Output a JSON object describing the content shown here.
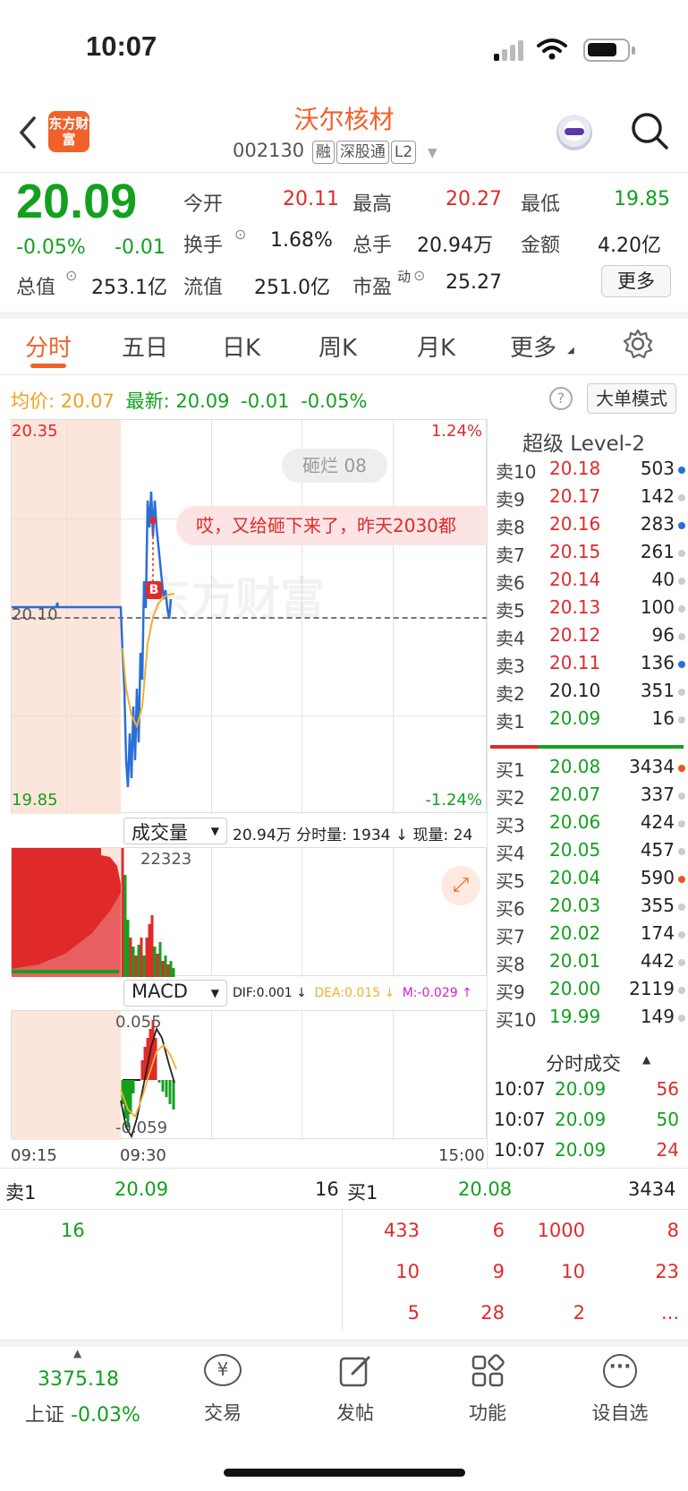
{
  "status_bar": {
    "time": "10:07"
  },
  "header": {
    "logo_text": "东方财富",
    "stock_name": "沃尔核材",
    "stock_code": "002130",
    "tags": [
      "融",
      "深股通",
      "L2"
    ]
  },
  "quote": {
    "price": "20.09",
    "change_pct": "-0.05%",
    "change": "-0.01",
    "open_label": "今开",
    "open": "20.11",
    "high_label": "最高",
    "high": "20.27",
    "low_label": "最低",
    "low": "19.85",
    "turnover_label": "换手",
    "turnover": "1.68%",
    "volume_label": "总手",
    "volume": "20.94万",
    "amount_label": "金额",
    "amount": "4.20亿",
    "mktcap_label": "总值",
    "mktcap": "253.1亿",
    "float_label": "流值",
    "float": "251.0亿",
    "pe_label": "市盈",
    "pe_sup": "动",
    "pe": "25.27",
    "more": "更多"
  },
  "tabs": [
    "分时",
    "五日",
    "日K",
    "周K",
    "月K",
    "更多"
  ],
  "avg_bar": {
    "avg_label": "均价:",
    "avg": "20.07",
    "latest_label": "最新:",
    "latest": "20.09",
    "chg": "-0.01",
    "chg_pct": "-0.05%",
    "mode": "大单模式"
  },
  "chart": {
    "y_top": "20.35",
    "y_mid": "20.10",
    "y_bottom": "19.85",
    "pct_top": "1.24%",
    "pct_bottom": "-1.24%",
    "watermark": "东方财富",
    "comment_user": "砸烂 08",
    "comment_text": "哎，又给砸下来了，昨天2030都",
    "marker": "B",
    "x_start": "09:15",
    "x_open": "09:30",
    "x_end": "15:00"
  },
  "volume_panel": {
    "selector": "成交量",
    "info": "20.94万 分时量: 1934 ↓ 现量: 24",
    "max_label": "22323"
  },
  "macd_panel": {
    "selector": "MACD",
    "dif": "DIF:0.001 ↓",
    "dea": "DEA:0.015 ↓",
    "m": "M:-0.029 ↑",
    "max_label": "0.055",
    "min_label": "-0.059"
  },
  "order_book": {
    "title": "超级 Level-2",
    "asks": [
      {
        "name": "卖10",
        "price": "20.18",
        "vol": "503",
        "dot": "#2a6fd6"
      },
      {
        "name": "卖9",
        "price": "20.17",
        "vol": "142",
        "dot": "#cccccc"
      },
      {
        "name": "卖8",
        "price": "20.16",
        "vol": "283",
        "dot": "#2a6fd6"
      },
      {
        "name": "卖7",
        "price": "20.15",
        "vol": "261",
        "dot": "#cccccc"
      },
      {
        "name": "卖6",
        "price": "20.14",
        "vol": "40",
        "dot": "#cccccc"
      },
      {
        "name": "卖5",
        "price": "20.13",
        "vol": "100",
        "dot": "#cccccc"
      },
      {
        "name": "卖4",
        "price": "20.12",
        "vol": "96",
        "dot": "#cccccc"
      },
      {
        "name": "卖3",
        "price": "20.11",
        "vol": "136",
        "dot": "#2a6fd6"
      },
      {
        "name": "卖2",
        "price": "20.10",
        "vol": "351",
        "dot": "#cccccc"
      },
      {
        "name": "卖1",
        "price": "20.09",
        "vol": "16",
        "dot": "#cccccc"
      }
    ],
    "bids": [
      {
        "name": "买1",
        "price": "20.08",
        "vol": "3434",
        "dot": "#e8581c"
      },
      {
        "name": "买2",
        "price": "20.07",
        "vol": "337",
        "dot": "#cccccc"
      },
      {
        "name": "买3",
        "price": "20.06",
        "vol": "424",
        "dot": "#cccccc"
      },
      {
        "name": "买4",
        "price": "20.05",
        "vol": "457",
        "dot": "#cccccc"
      },
      {
        "name": "买5",
        "price": "20.04",
        "vol": "590",
        "dot": "#e8581c"
      },
      {
        "name": "买6",
        "price": "20.03",
        "vol": "355",
        "dot": "#cccccc"
      },
      {
        "name": "买7",
        "price": "20.02",
        "vol": "174",
        "dot": "#cccccc"
      },
      {
        "name": "买8",
        "price": "20.01",
        "vol": "442",
        "dot": "#cccccc"
      },
      {
        "name": "买9",
        "price": "20.00",
        "vol": "2119",
        "dot": "#cccccc"
      },
      {
        "name": "买10",
        "price": "19.99",
        "vol": "149",
        "dot": "#cccccc"
      }
    ],
    "trades_title": "分时成交",
    "trades": [
      {
        "time": "10:07",
        "price": "20.09",
        "vol": "56"
      },
      {
        "time": "10:07",
        "price": "20.09",
        "vol": "50"
      },
      {
        "time": "10:07",
        "price": "20.09",
        "vol": "24"
      }
    ]
  },
  "queue": {
    "ask_label": "卖1",
    "ask_price": "20.09",
    "ask_vol": "16",
    "bid_label": "买1",
    "bid_price": "20.08",
    "bid_vol": "3434",
    "ask_orders": [
      "16"
    ],
    "bid_orders": [
      "433",
      "6",
      "1000",
      "8",
      "10",
      "9",
      "10",
      "23",
      "5",
      "28",
      "2",
      "..."
    ]
  },
  "bottom_nav": {
    "index_value": "3375.18",
    "index_name": "上证",
    "index_chg": "-0.03%",
    "items": [
      "交易",
      "发帖",
      "功能",
      "设自选"
    ]
  },
  "colors": {
    "up": "#e02a2a",
    "down": "#14a01f",
    "brand": "#f0622a",
    "avg_line": "#f0b030",
    "price_line": "#2a6fd6"
  }
}
